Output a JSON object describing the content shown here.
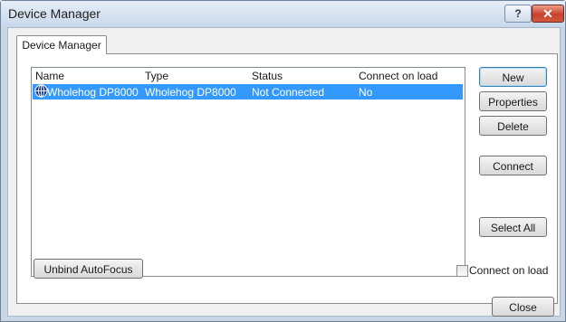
{
  "window": {
    "title": "Device Manager",
    "help_label": "?",
    "close_label": "✕"
  },
  "tabs": [
    {
      "label": "Device Manager",
      "active": true
    }
  ],
  "device_list": {
    "columns": [
      "Name",
      "Type",
      "Status",
      "Connect on load"
    ],
    "rows": [
      {
        "name": "Wholehog DP8000",
        "type": "Wholehog DP8000",
        "status": "Not Connected",
        "connect_on_load": "No",
        "selected": true,
        "icon": "device-globe-icon"
      }
    ]
  },
  "buttons": {
    "new": "New",
    "properties": "Properties",
    "delete": "Delete",
    "connect": "Connect",
    "select_all": "Select All",
    "unbind_autofocus": "Unbind AutoFocus",
    "close": "Close"
  },
  "connect_on_load": {
    "label": "Connect on load",
    "checked": false
  },
  "colors": {
    "selection": "#3399ff",
    "title_close": "#c8412c"
  }
}
